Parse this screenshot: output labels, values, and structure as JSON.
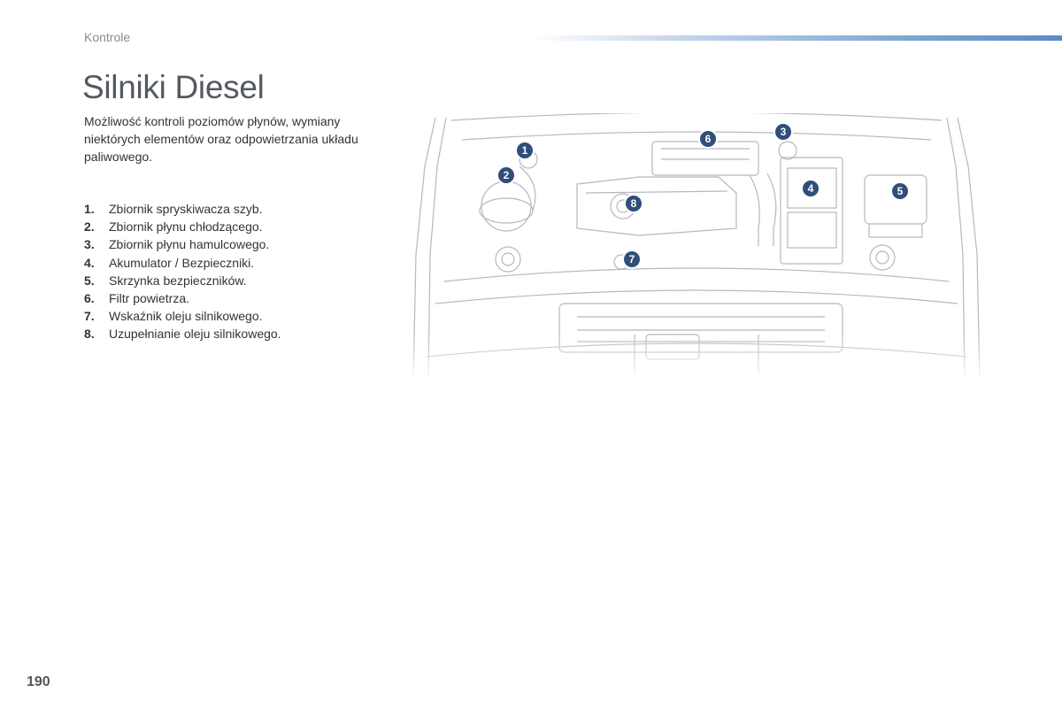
{
  "header": {
    "section": "Kontrole"
  },
  "title": "Silniki Diesel",
  "intro": "Możliwość kontroli poziomów płynów, wymiany niektórych elementów oraz odpowietrzania układu paliwowego.",
  "parts": [
    {
      "num": "1.",
      "label": "Zbiornik spryskiwacza szyb."
    },
    {
      "num": "2.",
      "label": "Zbiornik płynu chłodzącego."
    },
    {
      "num": "3.",
      "label": "Zbiornik płynu hamulcowego."
    },
    {
      "num": "4.",
      "label": "Akumulator / Bezpieczniki."
    },
    {
      "num": "5.",
      "label": "Skrzynka bezpieczników."
    },
    {
      "num": "6.",
      "label": "Filtr powietrza."
    },
    {
      "num": "7.",
      "label": "Wskaźnik oleju silnikowego."
    },
    {
      "num": "8.",
      "label": "Uzupełnianie oleju silnikowego."
    }
  ],
  "callouts": [
    "1",
    "2",
    "3",
    "4",
    "5",
    "6",
    "7",
    "8"
  ],
  "page_number": "190",
  "colors": {
    "accent": "#5a8cc4",
    "callout": "#2f4e7a",
    "line": "#b5b8bd"
  }
}
